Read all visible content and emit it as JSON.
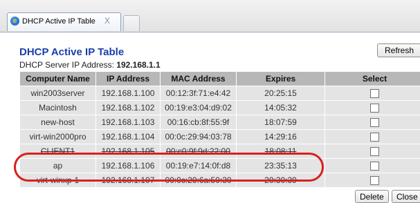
{
  "browser": {
    "tab_title": "DHCP Active IP Table",
    "tab_close": "X"
  },
  "page": {
    "title": "DHCP Active IP Table",
    "refresh_label": "Refresh",
    "server_label": "DHCP Server IP Address:",
    "server_ip": "192.168.1.1"
  },
  "table": {
    "headers": [
      "Computer Name",
      "IP Address",
      "MAC Address",
      "Expires",
      "Select"
    ],
    "rows": [
      [
        "win2003server",
        "192.168.1.100",
        "00:12:3f:71:e4:42",
        "20:25:15"
      ],
      [
        "Macintosh",
        "192.168.1.102",
        "00:19:e3:04:d9:02",
        "14:05:32"
      ],
      [
        "new-host",
        "192.168.1.103",
        "00:16:cb:8f:55:9f",
        "18:07:59"
      ],
      [
        "virt-win2000pro",
        "192.168.1.104",
        "00:0c:29:94:03:78",
        "14:29:16"
      ],
      [
        "CLIENT1",
        "192.168.1.105",
        "00:c0:9f:9d:22:00",
        "18:08:11"
      ],
      [
        "ap",
        "192.168.1.106",
        "00:19:e7:14:0f:d8",
        "23:35:13"
      ],
      [
        "virt-winxp-1",
        "192.168.1.107",
        "00:0c:29:6a:50:30",
        "20:30:39"
      ]
    ]
  },
  "footer": {
    "delete_label": "Delete",
    "close_label": "Close"
  },
  "colors": {
    "title": "#1a3dab",
    "header_bg": "#b7b7b7",
    "row_bg": "#e4e4e4",
    "highlight": "#d8201c"
  }
}
